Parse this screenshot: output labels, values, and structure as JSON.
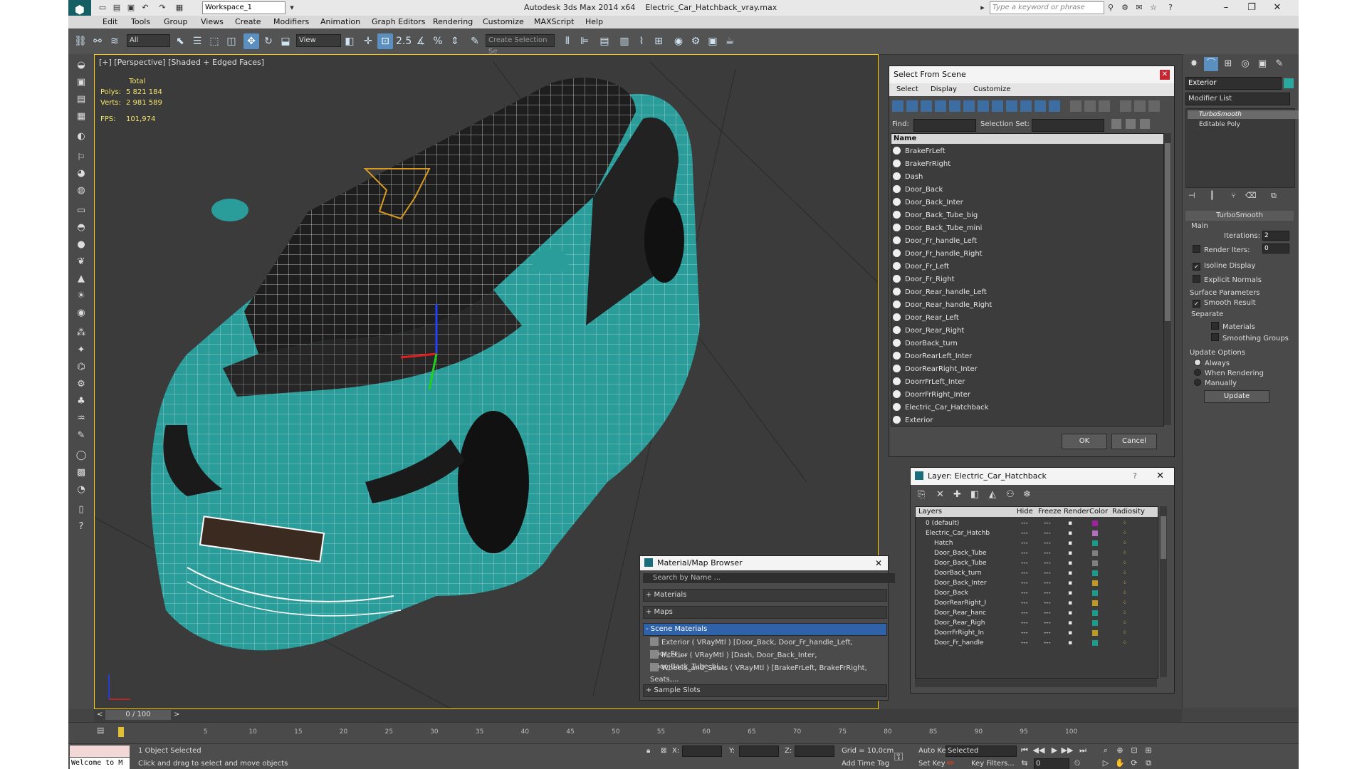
{
  "window": {
    "app_title": "Autodesk 3ds Max  2014 x64",
    "file_name": "Electric_Car_Hatchback_vray.max",
    "workspace": "Workspace_1",
    "search_placeholder": "Type a keyword or phrase"
  },
  "menu": [
    "Edit",
    "Tools",
    "Group",
    "Views",
    "Create",
    "Modifiers",
    "Animation",
    "Graph Editors",
    "Rendering",
    "Customize",
    "MAXScript",
    "Help"
  ],
  "toolbar": {
    "selection_filter": "All",
    "ref_coord": "View",
    "snap_label": "2.5",
    "percent_label": "%",
    "named_selection_placeholder": "Create Selection Se"
  },
  "viewport": {
    "label": "[+] [Perspective] [Shaded + Edged Faces]",
    "stats_header": "Total",
    "polys_label": "Polys:",
    "polys_value": "5 821 184",
    "verts_label": "Verts:",
    "verts_value": "2 981 589",
    "fps_label": "FPS:",
    "fps_value": "101,974",
    "colors": {
      "body": "#2a9d9a",
      "wire": "#ffffff",
      "glass": "#1e1e1e",
      "bg": "#3b3b3b"
    }
  },
  "select_from_scene": {
    "title": "Select From Scene",
    "menu": [
      "Select",
      "Display",
      "Customize"
    ],
    "find_label": "Find:",
    "selection_set_label": "Selection Set:",
    "column_name": "Name",
    "items": [
      "BrakeFrLeft",
      "BrakeFrRight",
      "Dash",
      "Door_Back",
      "Door_Back_Inter",
      "Door_Back_Tube_big",
      "Door_Back_Tube_mini",
      "Door_Fr_handle_Left",
      "Door_Fr_handle_Right",
      "Door_Fr_Left",
      "Door_Fr_Right",
      "Door_Rear_handle_Left",
      "Door_Rear_handle_Right",
      "Door_Rear_Left",
      "Door_Rear_Right",
      "DoorBack_turn",
      "DoorRearLeft_Inter",
      "DoorRearRight_Inter",
      "DoorrFrLeft_Inter",
      "DoorrFrRight_Inter",
      "Electric_Car_Hatchback",
      "Exterior"
    ],
    "ok": "OK",
    "cancel": "Cancel"
  },
  "layer_dialog": {
    "title": "Layer: Electric_Car_Hatchback",
    "help": "?",
    "columns": [
      "Layers",
      "Hide",
      "Freeze",
      "Render",
      "Color",
      "Radiosity"
    ],
    "rows": [
      {
        "name": "0 (default)",
        "color": "#a020a0"
      },
      {
        "name": "Electric_Car_Hatchb",
        "color": "#b070c0"
      },
      {
        "name": "Hatch",
        "color": "#1a9d8a"
      },
      {
        "name": "Door_Back_Tube",
        "color": "#808080"
      },
      {
        "name": "Door_Back_Tube",
        "color": "#808080"
      },
      {
        "name": "DoorBack_turn",
        "color": "#1a9d8a"
      },
      {
        "name": "Door_Back_Inter",
        "color": "#c09a20"
      },
      {
        "name": "Door_Back",
        "color": "#1a9d8a"
      },
      {
        "name": "DoorRearRight_I",
        "color": "#c09a20"
      },
      {
        "name": "Door_Rear_hanc",
        "color": "#1a9d8a"
      },
      {
        "name": "Door_Rear_Righ",
        "color": "#1a9d8a"
      },
      {
        "name": "DoorrFrRight_In",
        "color": "#c09a20"
      },
      {
        "name": "Door_Fr_handle",
        "color": "#1a9d8a"
      }
    ]
  },
  "material_browser": {
    "title": "Material/Map Browser",
    "search_placeholder": "Search by Name ...",
    "sections": [
      "+ Materials",
      "+ Maps",
      "- Scene Materials"
    ],
    "materials": [
      "Exterior  ( VRayMtl )  [Door_Back, Door_Fr_handle_Left, Door_Fr_...",
      "Interior  ( VRayMtl )  [Dash, Door_Back_Inter, Door_Back_Tube_bi...",
      "Wheels_and_Seats  ( VRayMtl )  [BrakeFrLeft, BrakeFrRight, Seats,..."
    ],
    "sample_slots": "+ Sample Slots"
  },
  "command_panel": {
    "object_name": "Exterior",
    "object_color": "#2aa8a0",
    "modifier_list": "Modifier List",
    "stack": [
      "TurboSmooth",
      "Editable Poly"
    ],
    "rollout_title": "TurboSmooth",
    "main_label": "Main",
    "iterations_label": "Iterations:",
    "iterations_value": "2",
    "render_iters_label": "Render Iters:",
    "render_iters_value": "0",
    "isoline": "Isoline Display",
    "explicit_normals": "Explicit Normals",
    "surface_params": "Surface Parameters",
    "smooth_result": "Smooth Result",
    "separate": "Separate",
    "materials": "Materials",
    "smoothing_groups": "Smoothing Groups",
    "update_options": "Update Options",
    "always": "Always",
    "when_rendering": "When Rendering",
    "manually": "Manually",
    "update_btn": "Update"
  },
  "timeline": {
    "frame_label": "0 / 100",
    "ticks": [
      "5",
      "10",
      "15",
      "20",
      "25",
      "30",
      "35",
      "40",
      "45",
      "50",
      "55",
      "60",
      "65",
      "70",
      "75",
      "80",
      "85",
      "90",
      "95",
      "100"
    ]
  },
  "status": {
    "maxscript": "Welcome to M",
    "selected": "1 Object Selected",
    "prompt": "Click and drag to select and move objects",
    "x_label": "X:",
    "y_label": "Y:",
    "z_label": "Z:",
    "grid": "Grid = 10,0cm",
    "add_time_tag": "Add Time Tag",
    "auto_key": "Auto Key",
    "set_key": "Set Key",
    "selected_dropdown": "Selected",
    "key_filters": "Key Filters...",
    "frame_value": "0"
  }
}
